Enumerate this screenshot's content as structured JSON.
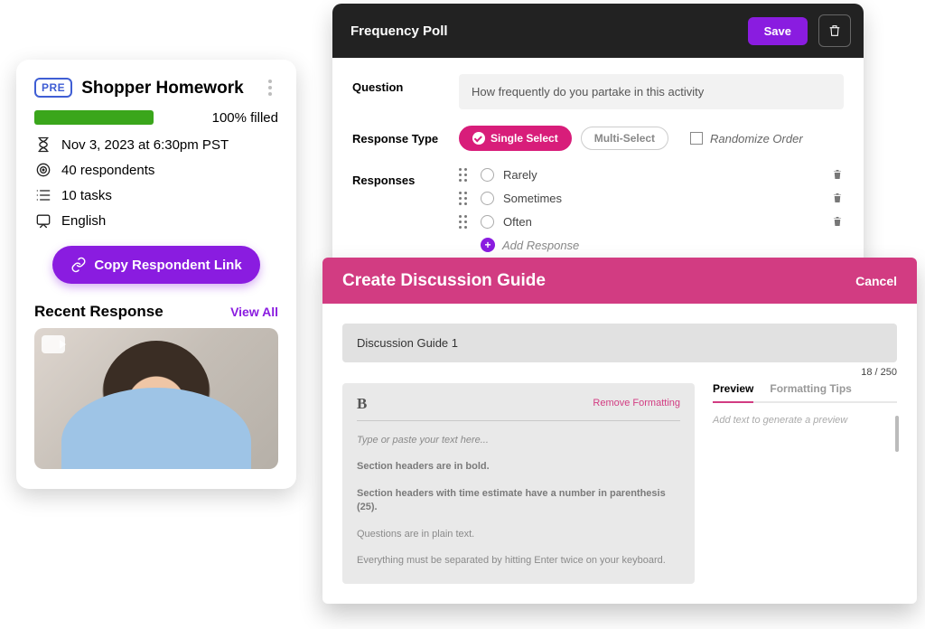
{
  "card": {
    "pre_badge": "PRE",
    "title": "Shopper Homework",
    "progress_pct": 100,
    "progress_label": "100% filled",
    "due": "Nov 3, 2023 at 6:30pm PST",
    "respondents": "40 respondents",
    "tasks": "10 tasks",
    "language": "English",
    "copy_btn": "Copy Respondent Link",
    "recent_label": "Recent Response",
    "view_all": "View All"
  },
  "poll": {
    "header": "Frequency Poll",
    "save": "Save",
    "labels": {
      "question": "Question",
      "response_type": "Response Type",
      "responses": "Responses"
    },
    "question_value": "How frequently do you partake in this activity",
    "types": {
      "single": "Single Select",
      "multi": "Multi-Select"
    },
    "randomize": "Randomize Order",
    "options": [
      "Rarely",
      "Sometimes",
      "Often"
    ],
    "add_response": "Add Response"
  },
  "guide": {
    "header": "Create Discussion Guide",
    "cancel": "Cancel",
    "title_value": "Discussion Guide 1",
    "counter": "18 / 250",
    "remove_fmt": "Remove Formatting",
    "editor_lines": {
      "placeholder": "Type or paste your text here...",
      "l1": "Section headers are in bold.",
      "l2": "Section headers with time estimate have a number in parenthesis (25).",
      "l3": "Questions are in plain text.",
      "l4": "Everything must be separated by hitting Enter twice on your keyboard."
    },
    "tabs": {
      "preview": "Preview",
      "tips": "Formatting Tips"
    },
    "preview_placeholder": "Add text to generate a preview"
  }
}
